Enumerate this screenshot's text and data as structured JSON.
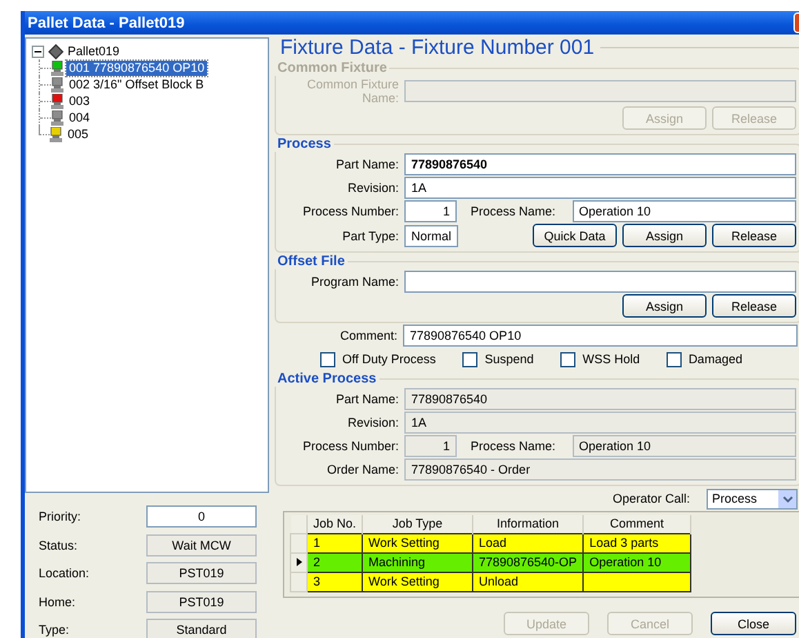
{
  "window": {
    "title": "Pallet Data - Pallet019"
  },
  "tree": {
    "label": "Pallet019",
    "expanded": true,
    "children": [
      {
        "label": "001 77890876540 OP10",
        "color": "#10c010",
        "selected": true
      },
      {
        "label": "002 3/16\" Offset Block B",
        "color": "#8c8c8c",
        "selected": false
      },
      {
        "label": "003",
        "color": "#e01010",
        "selected": false
      },
      {
        "label": "004",
        "color": "#8c8c8c",
        "selected": false
      },
      {
        "label": "005",
        "color": "#e8d000",
        "selected": false
      }
    ]
  },
  "pallet_info": [
    {
      "label": "Priority:",
      "value": "0",
      "read_only": false
    },
    {
      "label": "Status:",
      "value": "Wait MCW",
      "read_only": true
    },
    {
      "label": "Location:",
      "value": "PST019",
      "read_only": true
    },
    {
      "label": "Home:",
      "value": "PST019",
      "read_only": true
    },
    {
      "label": "Type:",
      "value": "Standard",
      "read_only": true
    }
  ],
  "fixture": {
    "title": "Fixture Data - Fixture Number 001",
    "sections": [
      {
        "kind": "group",
        "title": "Common Fixture",
        "disabled": true,
        "rows": [
          {
            "label": "Common Fixture Name:",
            "cells": [
              {
                "kind": "field",
                "read_only": true
              }
            ]
          },
          {
            "cells": [
              {
                "kind": "button",
                "label": "Assign",
                "disabled": true
              },
              {
                "kind": "button",
                "label": "Release",
                "disabled": true
              }
            ]
          }
        ]
      },
      {
        "kind": "group",
        "title": "Process",
        "disabled": false,
        "rows": [
          {
            "label": "Part Name:",
            "cells": [
              {
                "kind": "field",
                "value": "77890876540",
                "read_only": false,
                "bold": true
              }
            ]
          },
          {
            "label": "Revision:",
            "cells": [
              {
                "kind": "field",
                "value": "1A",
                "read_only": false
              }
            ]
          },
          {
            "label": "Process Number:",
            "cells": [
              {
                "kind": "field",
                "value": "1",
                "read_only": false,
                "numeric": true
              },
              {
                "kind": "label",
                "text": "Process Name:"
              },
              {
                "kind": "field",
                "value": "Operation 10",
                "read_only": false
              }
            ]
          },
          {
            "label": "Part Type:",
            "cells": [
              {
                "kind": "field",
                "value": "Normal",
                "read_only": false
              },
              {
                "kind": "button",
                "label": "Quick Data",
                "disabled": false
              },
              {
                "kind": "button",
                "label": "Assign",
                "disabled": false
              },
              {
                "kind": "button",
                "label": "Release",
                "disabled": false
              }
            ]
          }
        ]
      },
      {
        "kind": "group",
        "title": "Offset File",
        "disabled": false,
        "rows": [
          {
            "label": "Program Name:",
            "cells": [
              {
                "kind": "field",
                "read_only": false
              }
            ]
          },
          {
            "cells": [
              {
                "kind": "button",
                "label": "Assign",
                "disabled": false
              },
              {
                "kind": "button",
                "label": "Release",
                "disabled": false
              }
            ]
          }
        ]
      },
      {
        "kind": "plain",
        "rows": [
          {
            "label": "Comment:",
            "cells": [
              {
                "kind": "field",
                "value": "77890876540 OP10",
                "read_only": false
              }
            ]
          },
          {
            "cells": [
              {
                "kind": "checkbox",
                "label": "Off Duty Process",
                "checked": false
              },
              {
                "kind": "checkbox",
                "label": "Suspend",
                "checked": false
              },
              {
                "kind": "checkbox",
                "label": "WSS Hold",
                "checked": false
              },
              {
                "kind": "checkbox",
                "label": "Damaged",
                "checked": false
              }
            ]
          }
        ]
      },
      {
        "kind": "group",
        "title": "Active Process",
        "disabled": false,
        "rows": [
          {
            "label": "Part Name:",
            "cells": [
              {
                "kind": "field",
                "value": "77890876540",
                "read_only": true
              }
            ]
          },
          {
            "label": "Revision:",
            "cells": [
              {
                "kind": "field",
                "value": "1A",
                "read_only": true
              }
            ]
          },
          {
            "label": "Process Number:",
            "cells": [
              {
                "kind": "field",
                "value": "1",
                "read_only": true,
                "numeric": true
              },
              {
                "kind": "label",
                "text": "Process Name:"
              },
              {
                "kind": "field",
                "value": "Operation 10",
                "read_only": true
              }
            ]
          },
          {
            "label": "Order Name:",
            "cells": [
              {
                "kind": "field",
                "value": "77890876540 - Order",
                "read_only": true
              }
            ]
          }
        ]
      },
      {
        "kind": "plain",
        "rows": [
          {
            "cells": [
              {
                "kind": "label",
                "text": "Operator Call:"
              },
              {
                "kind": "select",
                "value": "Process"
              }
            ]
          }
        ]
      }
    ]
  },
  "jobs": {
    "columns": [
      "Job No.",
      "Job Type",
      "Information",
      "Comment"
    ],
    "rows": [
      {
        "cells": [
          "1",
          "Work Setting",
          "Load",
          "Load 3 parts"
        ],
        "color": "#ffff00",
        "selected": false
      },
      {
        "cells": [
          "2",
          "Machining",
          "77890876540-OP",
          "Operation 10"
        ],
        "color": "#66ee00",
        "selected": true
      },
      {
        "cells": [
          "3",
          "Work Setting",
          "Unload"
        ],
        "color": "#ffff00",
        "selected": false
      }
    ]
  },
  "buttons": [
    {
      "label": "Update",
      "disabled": true
    },
    {
      "label": "Cancel",
      "disabled": true
    },
    {
      "label": "Close",
      "disabled": false
    }
  ]
}
